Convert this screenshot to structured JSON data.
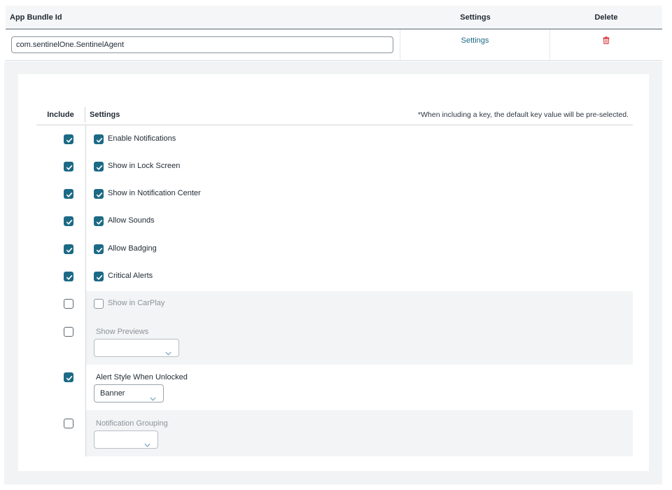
{
  "table": {
    "headers": {
      "bundle_id": "App Bundle Id",
      "settings": "Settings",
      "delete": "Delete"
    },
    "row": {
      "bundle_value": "com.sentinelOne.SentinelAgent",
      "settings_link": "Settings",
      "delete_icon": "trash-icon"
    }
  },
  "settings_panel": {
    "include_header": "Include",
    "settings_header": "Settings",
    "note": "*When including a key, the default key value will be pre-selected.",
    "items": [
      {
        "label": "Enable Notifications",
        "include": true,
        "value": true
      },
      {
        "label": "Show in Lock Screen",
        "include": true,
        "value": true
      },
      {
        "label": "Show in Notification Center",
        "include": true,
        "value": true
      },
      {
        "label": "Allow Sounds",
        "include": true,
        "value": true
      },
      {
        "label": "Allow Badging",
        "include": true,
        "value": true
      },
      {
        "label": "Critical Alerts",
        "include": true,
        "value": true
      },
      {
        "label": "Show in CarPlay",
        "include": false,
        "value": false
      },
      {
        "label": "Show Previews",
        "include": false,
        "value": ""
      },
      {
        "label": "Alert Style When Unlocked",
        "include": true,
        "value": "Banner"
      },
      {
        "label": "Notification Grouping",
        "include": false,
        "value": ""
      }
    ]
  },
  "colors": {
    "accent": "#1c6a85",
    "delete": "#d9363e",
    "disabled_bg": "#f2f4f5"
  }
}
